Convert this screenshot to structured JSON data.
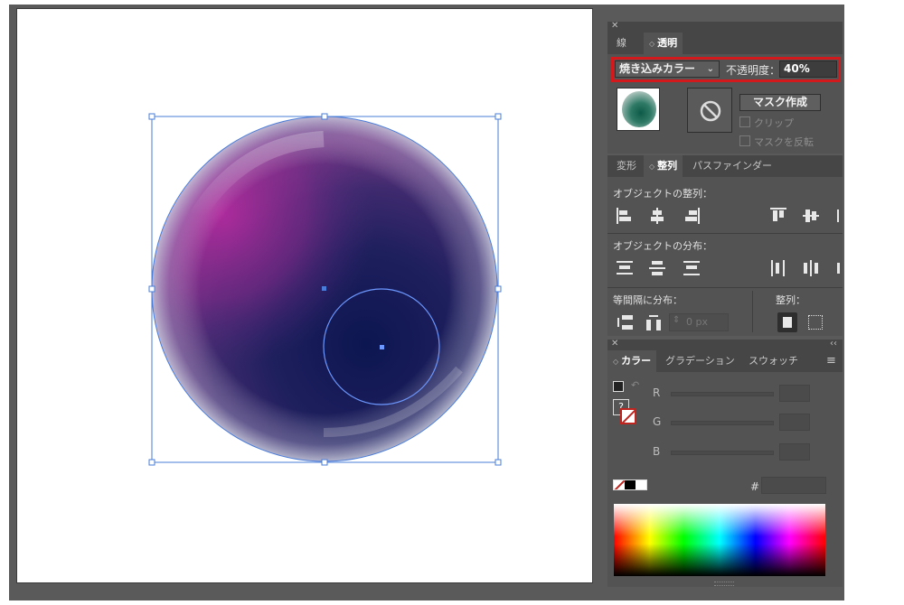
{
  "transparency_panel": {
    "tabs": [
      "線",
      "透明"
    ],
    "active_tab": "透明",
    "blend_mode": "焼き込みカラー",
    "opacity_label": "不透明度：",
    "opacity_value": "40%",
    "make_mask_label": "マスク作成",
    "clip_label": "クリップ",
    "invert_mask_label": "マスクを反転"
  },
  "align_panel": {
    "tabs": [
      "変形",
      "整列",
      "パスファインダー"
    ],
    "active_tab": "整列",
    "align_objects_label": "オブジェクトの整列：",
    "distribute_objects_label": "オブジェクトの分布：",
    "distribute_spacing_label": "等間隔に分布：",
    "align_to_label": "整列：",
    "spacing_value": "0 px",
    "icons": [
      "align-left-icon",
      "align-hcenter-icon",
      "align-right-icon",
      "align-top-icon",
      "align-vcenter-icon",
      "distribute-top-icon",
      "distribute-vcenter-icon",
      "distribute-bottom-icon",
      "distribute-left-icon",
      "distribute-hcenter-icon",
      "distribute-vspace-icon",
      "distribute-hspace-icon",
      "align-to-artboard-icon",
      "align-to-selection-icon"
    ]
  },
  "color_panel": {
    "tabs": [
      "カラー",
      "グラデーション",
      "スウォッチ"
    ],
    "active_tab": "カラー",
    "channels": [
      "R",
      "G",
      "B"
    ],
    "hex_label": "#",
    "hex_value": ""
  },
  "colors": {
    "panel_bg": "#535353",
    "tab_bar_bg": "#464646",
    "highlight": "#d4191d",
    "selection": "#4a7cd9"
  }
}
